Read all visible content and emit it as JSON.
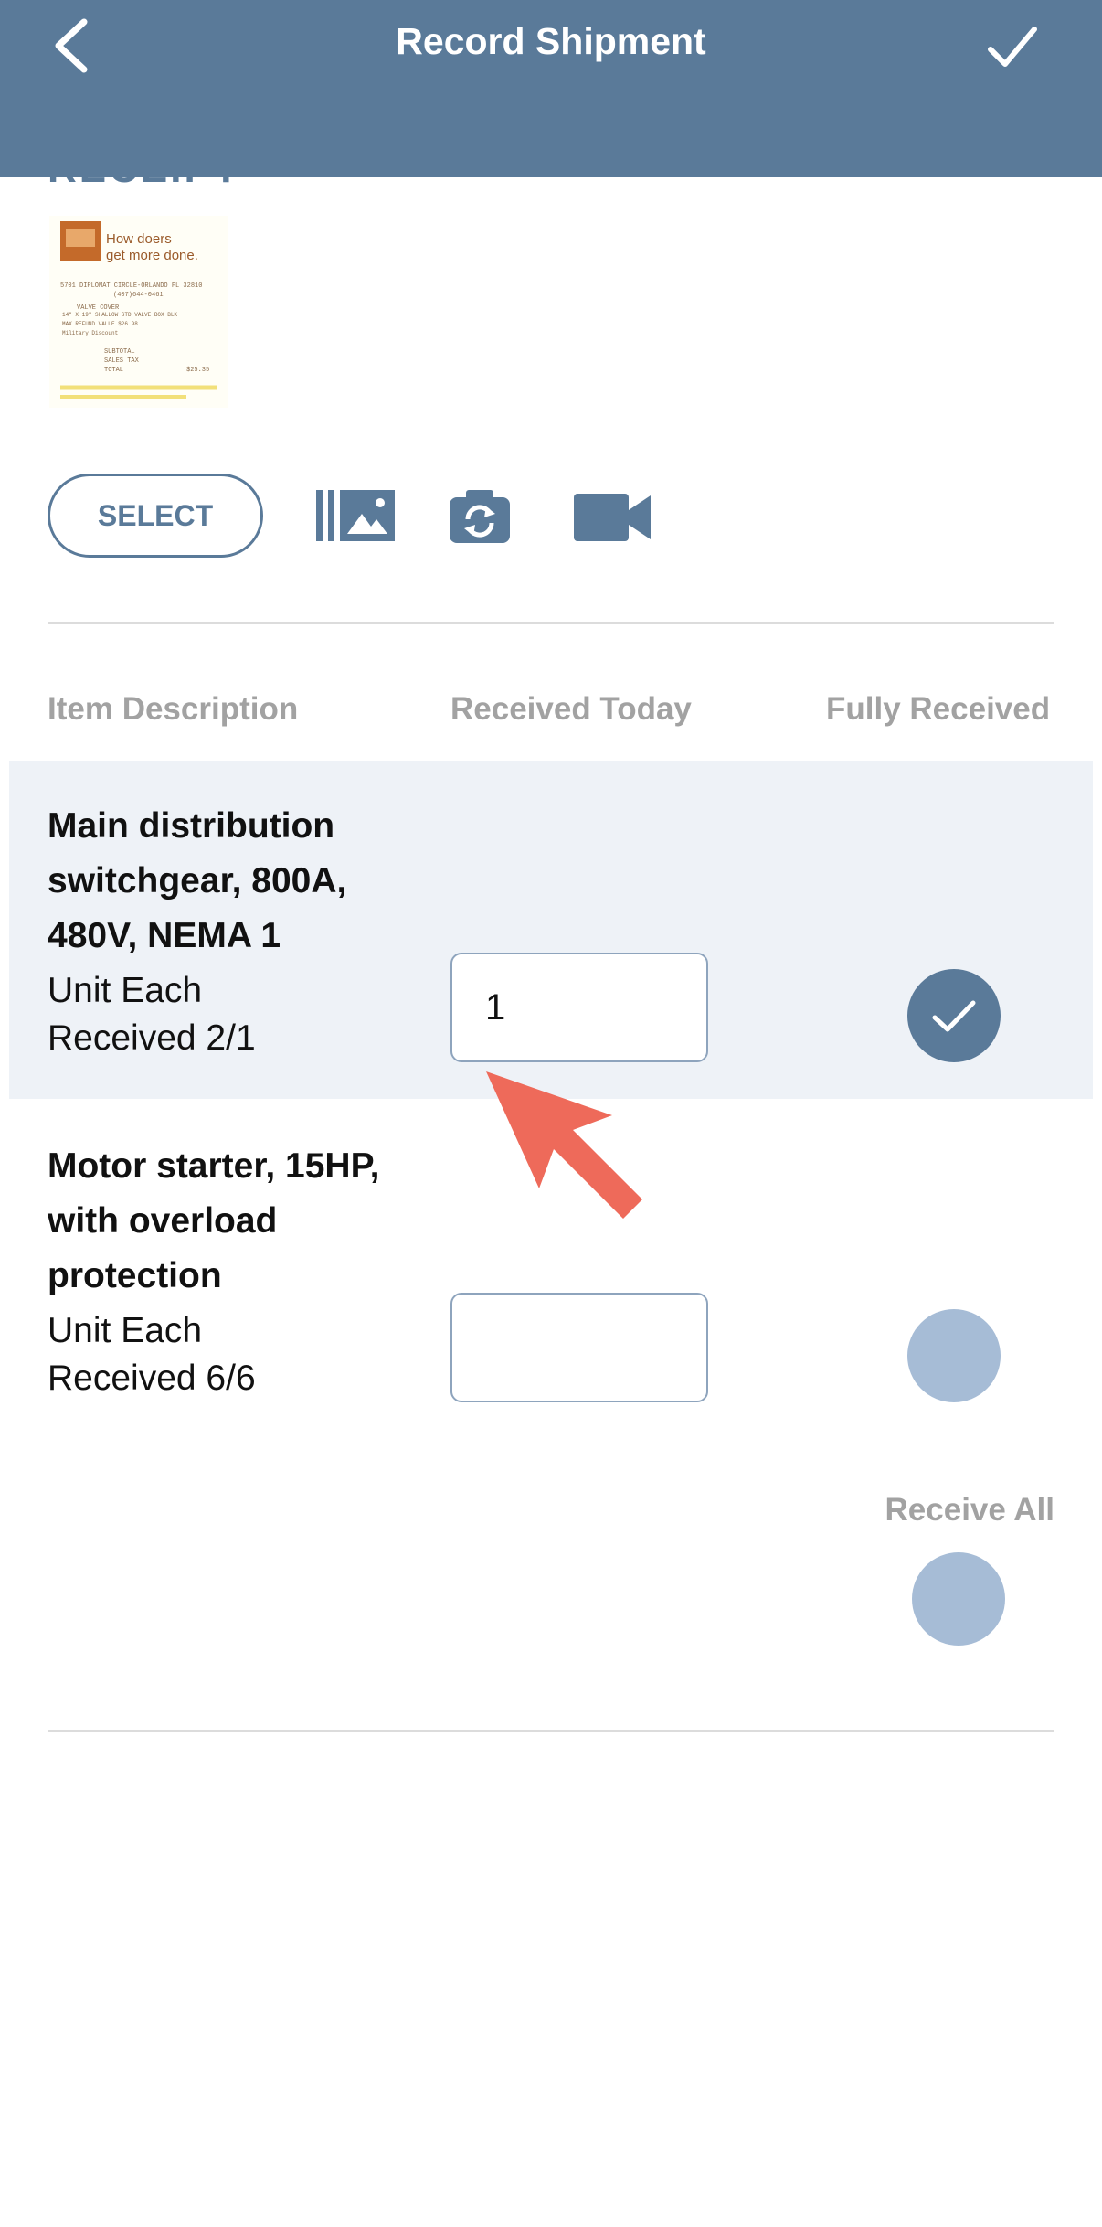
{
  "header": {
    "title": "Record Shipment"
  },
  "receipt": {
    "section_label": "RECEIPT",
    "thumbnail": {
      "tagline_1": "How doers",
      "tagline_2": "get more done.",
      "address": "5701 DIPLOMAT CIRCLE-ORLANDO FL 32810",
      "phone": "(407)644-0461",
      "item_line": "VALVE COVER",
      "item_line_2": "14\" X 19\" SHALLOW STD VALVE BOX BLK",
      "refund_line": "MAX REFUND VALUE $26.98",
      "discount_line": "Military Discount",
      "subtotal_label": "SUBTOTAL",
      "tax_label": "SALES TAX",
      "total_label": "TOTAL",
      "total_value": "$25.35"
    }
  },
  "toolbar": {
    "select_label": "SELECT",
    "icons": [
      "gallery-icon",
      "camera-switch-icon",
      "video-camera-icon"
    ]
  },
  "table": {
    "headers": [
      "Item Description",
      "Received Today",
      "Fully Received"
    ],
    "rows": [
      {
        "title_lines": [
          "Main distribution",
          "switchgear, 800A,",
          "480V, NEMA 1"
        ],
        "unit": "Unit Each",
        "received": "Received 2/1",
        "received_today": "1",
        "fully_received": true
      },
      {
        "title_lines": [
          "Motor starter, 15HP,",
          "with overload",
          "protection"
        ],
        "unit": "Unit Each",
        "received": "Received 6/6",
        "received_today": "",
        "fully_received": false
      }
    ]
  },
  "receive_all": {
    "label": "Receive All",
    "checked": false
  },
  "colors": {
    "header": "#5a7a99",
    "accent": "#5a7a99",
    "check_off": "#a6bcd6",
    "row_highlight": "#eef2f7",
    "annotation_arrow": "#ee6a5a"
  }
}
